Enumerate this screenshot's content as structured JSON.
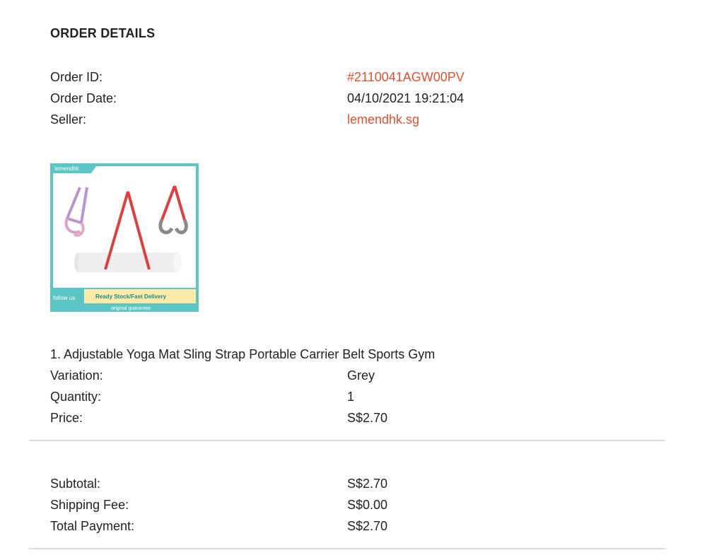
{
  "order": {
    "title": "ORDER DETAILS",
    "order_id_label": "Order ID:",
    "order_id_value": "#2110041AGW00PV",
    "order_date_label": "Order Date:",
    "order_date_value": "04/10/2021 19:21:04",
    "seller_label": "Seller:",
    "seller_value": "lemendhk.sg"
  },
  "product_image": {
    "shop_tag": "lemendhk",
    "follow_text": "follow us",
    "banner_text": "Ready Stock/Fast Delivery",
    "guarantee_text": "original guarantee",
    "border_color": "#5bc6c4"
  },
  "item": {
    "name": "1. Adjustable Yoga Mat Sling Strap Portable Carrier Belt Sports Gym",
    "variation_label": "Variation:",
    "variation_value": "Grey",
    "quantity_label": "Quantity:",
    "quantity_value": "1",
    "price_label": "Price:",
    "price_value": "S$2.70"
  },
  "totals": {
    "subtotal_label": "Subtotal:",
    "subtotal_value": "S$2.70",
    "shipping_label": "Shipping Fee:",
    "shipping_value": "S$0.00",
    "total_label": "Total Payment:",
    "total_value": "S$2.70"
  },
  "colors": {
    "accent": "#ee4d2d",
    "text": "#222222",
    "divider": "#dddddd"
  }
}
